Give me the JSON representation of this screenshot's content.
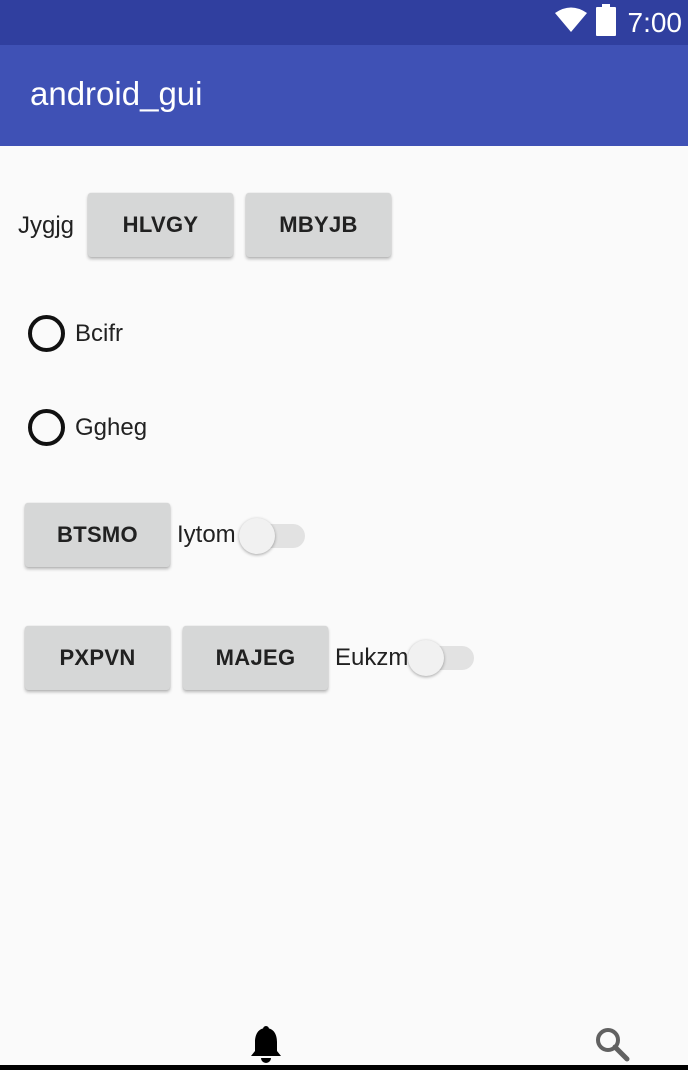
{
  "status_bar": {
    "time": "7:00",
    "icons": [
      "wifi-icon",
      "battery-icon"
    ],
    "background": "#303f9f"
  },
  "app_bar": {
    "title": "android_gui",
    "background": "#3f51b5"
  },
  "row1": {
    "label": "Jygjg",
    "buttons": [
      "HLVGY",
      "MBYJB"
    ]
  },
  "radios": [
    {
      "label": "Bcifr",
      "checked": false
    },
    {
      "label": "Ggheg",
      "checked": false
    }
  ],
  "row2": {
    "button": "BTSMO",
    "switch_label": "Iytom",
    "switch_on": false
  },
  "row3": {
    "buttons": [
      "PXPVN",
      "MAJEG"
    ],
    "switch_label": "Eukzm",
    "switch_on": false
  },
  "bottom_nav": {
    "icons": [
      "bell-icon",
      "search-icon"
    ]
  }
}
